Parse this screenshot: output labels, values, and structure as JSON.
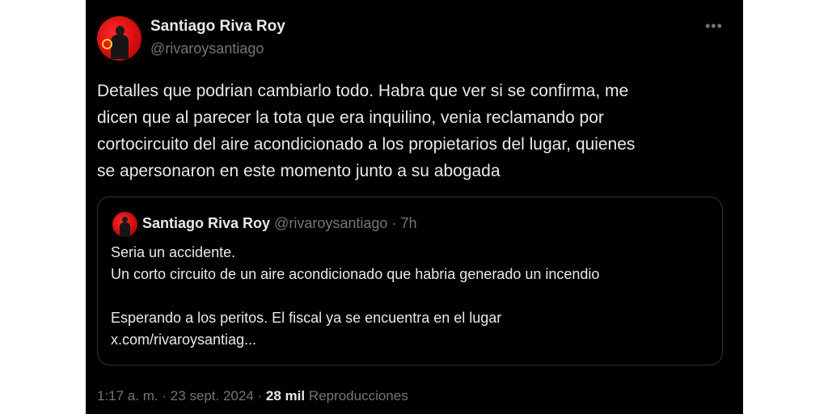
{
  "author": {
    "name": "Santiago Riva Roy",
    "handle": "@rivaroysantiago",
    "more_icon": "more-horizontal-icon",
    "more_glyph": "•••"
  },
  "tweet": {
    "lines": [
      "Detalles que podrian cambiarlo todo. Habra que ver si se confirma, me",
      "dicen que al parecer la tota que era inquilino, venia reclamando por",
      "cortocircuito del aire acondicionado a los propietarios del lugar, quienes",
      "se apersonaron en este momento junto a su abogada"
    ]
  },
  "quoted_tweet": {
    "name": "Santiago Riva Roy",
    "handle": "@rivaroysantiago",
    "separator": "·",
    "time": "7h",
    "lines": [
      "Seria un accidente.",
      "Un corto circuito de un aire acondicionado que habria generado un incendio",
      "",
      "Esperando a los peritos. El fiscal ya se encuentra en el lugar",
      "x.com/rivaroysantiag..."
    ]
  },
  "footer": {
    "time": "1:17 a. m.",
    "separator": "·",
    "date": "23 sept. 2024",
    "separator2": "·",
    "views_count": "28 mil",
    "views_label": "Reproducciones"
  },
  "colors": {
    "background": "#000000",
    "text": "#e7e9ea",
    "muted": "#71767b",
    "border": "#2f3336"
  }
}
